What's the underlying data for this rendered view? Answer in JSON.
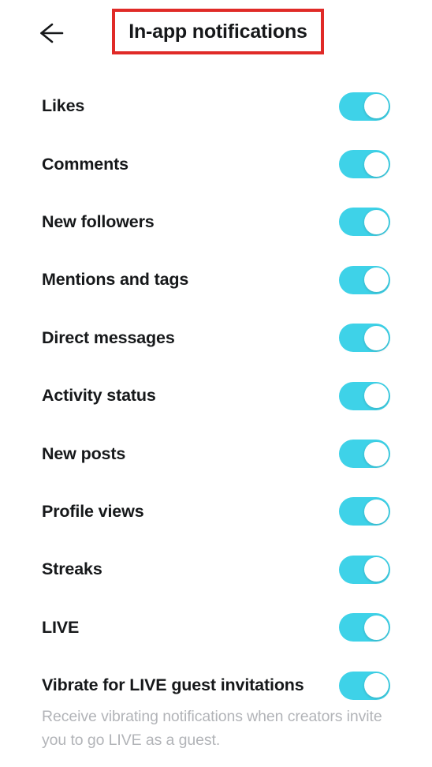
{
  "header": {
    "back_icon": "arrow-left-icon",
    "title": "In-app notifications",
    "highlight_color": "#e02a27"
  },
  "theme": {
    "toggle_on_color": "#3ed2e8",
    "label_color": "#16181a",
    "description_color": "#b2b4b8",
    "background": "#ffffff"
  },
  "settings": {
    "items": [
      {
        "label": "Likes",
        "state": "on"
      },
      {
        "label": "Comments",
        "state": "on"
      },
      {
        "label": "New followers",
        "state": "on"
      },
      {
        "label": "Mentions and tags",
        "state": "on"
      },
      {
        "label": "Direct messages",
        "state": "on"
      },
      {
        "label": "Activity status",
        "state": "on"
      },
      {
        "label": "New posts",
        "state": "on"
      },
      {
        "label": "Profile views",
        "state": "on"
      },
      {
        "label": "Streaks",
        "state": "on"
      },
      {
        "label": "LIVE",
        "state": "on"
      },
      {
        "label": "Vibrate for LIVE guest invitations",
        "state": "on"
      }
    ],
    "footer_description": "Receive vibrating notifications when creators invite you to go LIVE as a guest."
  }
}
